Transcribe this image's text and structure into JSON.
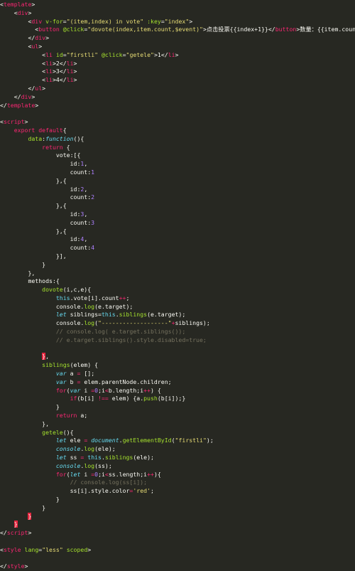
{
  "editor": {
    "lines": [
      [
        [
          "c-punct",
          "<"
        ],
        [
          "c-tag",
          "template"
        ],
        [
          "c-punct",
          ">"
        ]
      ],
      [
        [
          "c-plain",
          "    "
        ],
        [
          "c-punct",
          "<"
        ],
        [
          "c-tag",
          "div"
        ],
        [
          "c-punct",
          ">"
        ]
      ],
      [
        [
          "c-plain",
          "        "
        ],
        [
          "c-punct",
          "<"
        ],
        [
          "c-tag",
          "div"
        ],
        [
          "c-plain",
          " "
        ],
        [
          "c-attr",
          "v-for"
        ],
        [
          "c-punct",
          "="
        ],
        [
          "c-str",
          "\"(item,index) in vote\""
        ],
        [
          "c-plain",
          " "
        ],
        [
          "c-attr",
          ":key"
        ],
        [
          "c-punct",
          "="
        ],
        [
          "c-str",
          "\"index\""
        ],
        [
          "c-punct",
          ">"
        ]
      ],
      [
        [
          "c-plain",
          "          "
        ],
        [
          "c-punct",
          "<"
        ],
        [
          "c-tag",
          "button"
        ],
        [
          "c-plain",
          " "
        ],
        [
          "c-attr",
          "@click"
        ],
        [
          "c-punct",
          "="
        ],
        [
          "c-str",
          "\"dovote(index,item.count,$event)\""
        ],
        [
          "c-punct",
          ">"
        ],
        [
          "c-plain c-zh",
          "点击投票"
        ],
        [
          "c-plain",
          "{{index+1}}"
        ],
        [
          "c-punct",
          "</"
        ],
        [
          "c-tag",
          "button"
        ],
        [
          "c-punct",
          ">"
        ],
        [
          "c-plain c-zh",
          "数量："
        ],
        [
          "c-plain",
          "{{item.count}}"
        ]
      ],
      [
        [
          "c-plain",
          "        "
        ],
        [
          "c-punct",
          "</"
        ],
        [
          "c-tag",
          "div"
        ],
        [
          "c-punct",
          ">"
        ]
      ],
      [
        [
          "c-plain",
          "        "
        ],
        [
          "c-punct",
          "<"
        ],
        [
          "c-tag",
          "ul"
        ],
        [
          "c-punct",
          ">"
        ]
      ],
      [
        [
          "c-plain",
          "            "
        ],
        [
          "c-punct",
          "<"
        ],
        [
          "c-tag",
          "li"
        ],
        [
          "c-plain",
          " "
        ],
        [
          "c-attr",
          "id"
        ],
        [
          "c-punct",
          "="
        ],
        [
          "c-str",
          "\"firstli\""
        ],
        [
          "c-plain",
          " "
        ],
        [
          "c-attr",
          "@click"
        ],
        [
          "c-punct",
          "="
        ],
        [
          "c-str",
          "\"getele\""
        ],
        [
          "c-punct",
          ">"
        ],
        [
          "c-plain",
          "1"
        ],
        [
          "c-punct",
          "</"
        ],
        [
          "c-tag",
          "li"
        ],
        [
          "c-punct",
          ">"
        ]
      ],
      [
        [
          "c-plain",
          "            "
        ],
        [
          "c-punct",
          "<"
        ],
        [
          "c-tag",
          "li"
        ],
        [
          "c-punct",
          ">"
        ],
        [
          "c-plain",
          "2"
        ],
        [
          "c-punct",
          "</"
        ],
        [
          "c-tag",
          "li"
        ],
        [
          "c-punct",
          ">"
        ]
      ],
      [
        [
          "c-plain",
          "            "
        ],
        [
          "c-punct",
          "<"
        ],
        [
          "c-tag",
          "li"
        ],
        [
          "c-punct",
          ">"
        ],
        [
          "c-plain",
          "3"
        ],
        [
          "c-punct",
          "</"
        ],
        [
          "c-tag",
          "li"
        ],
        [
          "c-punct",
          ">"
        ]
      ],
      [
        [
          "c-plain",
          "            "
        ],
        [
          "c-punct",
          "<"
        ],
        [
          "c-tag",
          "li"
        ],
        [
          "c-punct",
          ">"
        ],
        [
          "c-plain",
          "4"
        ],
        [
          "c-punct",
          "</"
        ],
        [
          "c-tag",
          "li"
        ],
        [
          "c-punct",
          ">"
        ]
      ],
      [
        [
          "c-plain",
          "        "
        ],
        [
          "c-punct",
          "</"
        ],
        [
          "c-tag",
          "ul"
        ],
        [
          "c-punct",
          ">"
        ]
      ],
      [
        [
          "c-plain",
          "    "
        ],
        [
          "c-punct",
          "</"
        ],
        [
          "c-tag",
          "div"
        ],
        [
          "c-punct",
          ">"
        ]
      ],
      [
        [
          "c-punct",
          "</"
        ],
        [
          "c-tag",
          "template"
        ],
        [
          "c-punct",
          ">"
        ]
      ],
      [
        [
          "c-plain",
          ""
        ]
      ],
      [
        [
          "c-punct",
          "<"
        ],
        [
          "c-tag",
          "script"
        ],
        [
          "c-punct",
          ">"
        ]
      ],
      [
        [
          "c-plain",
          "    "
        ],
        [
          "c-kw",
          "export"
        ],
        [
          "c-plain",
          " "
        ],
        [
          "c-kw",
          "default"
        ],
        [
          "c-plain",
          "{"
        ]
      ],
      [
        [
          "c-plain",
          "        "
        ],
        [
          "c-fn",
          "data"
        ],
        [
          "c-plain",
          ":"
        ],
        [
          "c-storage",
          "function"
        ],
        [
          "c-plain",
          "(){"
        ]
      ],
      [
        [
          "c-plain",
          "            "
        ],
        [
          "c-kw",
          "return"
        ],
        [
          "c-plain",
          " {"
        ]
      ],
      [
        [
          "c-plain",
          "                "
        ],
        [
          "c-plain",
          "vote:[{"
        ]
      ],
      [
        [
          "c-plain",
          "                    "
        ],
        [
          "c-plain",
          "id:"
        ],
        [
          "c-num",
          "1"
        ],
        [
          "c-plain",
          ","
        ]
      ],
      [
        [
          "c-plain",
          "                    "
        ],
        [
          "c-plain",
          "count:"
        ],
        [
          "c-num",
          "1"
        ]
      ],
      [
        [
          "c-plain",
          "                "
        ],
        [
          "c-plain",
          "},{"
        ]
      ],
      [
        [
          "c-plain",
          "                    "
        ],
        [
          "c-plain",
          "id:"
        ],
        [
          "c-num",
          "2"
        ],
        [
          "c-plain",
          ","
        ]
      ],
      [
        [
          "c-plain",
          "                    "
        ],
        [
          "c-plain",
          "count:"
        ],
        [
          "c-num",
          "2"
        ]
      ],
      [
        [
          "c-plain",
          "                "
        ],
        [
          "c-plain",
          "},{"
        ]
      ],
      [
        [
          "c-plain",
          "                    "
        ],
        [
          "c-plain",
          "id:"
        ],
        [
          "c-num",
          "3"
        ],
        [
          "c-plain",
          ","
        ]
      ],
      [
        [
          "c-plain",
          "                    "
        ],
        [
          "c-plain",
          "count:"
        ],
        [
          "c-num",
          "3"
        ]
      ],
      [
        [
          "c-plain",
          "                "
        ],
        [
          "c-plain",
          "},{"
        ]
      ],
      [
        [
          "c-plain",
          "                    "
        ],
        [
          "c-plain",
          "id:"
        ],
        [
          "c-num",
          "4"
        ],
        [
          "c-plain",
          ","
        ]
      ],
      [
        [
          "c-plain",
          "                    "
        ],
        [
          "c-plain",
          "count:"
        ],
        [
          "c-num",
          "4"
        ]
      ],
      [
        [
          "c-plain",
          "                "
        ],
        [
          "c-plain",
          "}],"
        ]
      ],
      [
        [
          "c-plain",
          "            "
        ],
        [
          "c-plain",
          "}"
        ]
      ],
      [
        [
          "c-plain",
          "        "
        ],
        [
          "c-plain",
          "},"
        ]
      ],
      [
        [
          "c-plain",
          "        "
        ],
        [
          "c-plain",
          "methods:{"
        ]
      ],
      [
        [
          "c-plain",
          "            "
        ],
        [
          "c-fn",
          "dovote"
        ],
        [
          "c-plain",
          "(i,c,e){"
        ]
      ],
      [
        [
          "c-plain",
          "                "
        ],
        [
          "c-prop",
          "this"
        ],
        [
          "c-plain",
          ".vote["
        ],
        [
          "c-plain",
          "i"
        ],
        [
          "c-plain",
          "].count"
        ],
        [
          "c-kw",
          "++"
        ],
        [
          "c-plain",
          ";"
        ]
      ],
      [
        [
          "c-plain",
          "                "
        ],
        [
          "c-plain",
          "console."
        ],
        [
          "c-fn",
          "log"
        ],
        [
          "c-plain",
          "(e.target);"
        ]
      ],
      [
        [
          "c-plain",
          "                "
        ],
        [
          "c-storage",
          "let"
        ],
        [
          "c-plain",
          " siblings="
        ],
        [
          "c-prop",
          "this"
        ],
        [
          "c-plain",
          "."
        ],
        [
          "c-fn",
          "siblings"
        ],
        [
          "c-plain",
          "(e.target);"
        ]
      ],
      [
        [
          "c-plain",
          "                "
        ],
        [
          "c-plain",
          "console."
        ],
        [
          "c-fn",
          "log"
        ],
        [
          "c-plain",
          "("
        ],
        [
          "c-str",
          "\"-------------------\""
        ],
        [
          "c-kw",
          "+"
        ],
        [
          "c-plain",
          "siblings);"
        ]
      ],
      [
        [
          "c-plain",
          "                "
        ],
        [
          "c-comment",
          "// console.log( e.target.siblings());"
        ]
      ],
      [
        [
          "c-plain",
          "                "
        ],
        [
          "c-comment",
          "// e.target.siblings().style.disabled=true;"
        ]
      ],
      [
        [
          "c-plain",
          ""
        ]
      ],
      [
        [
          "c-plain",
          "            "
        ],
        [
          "c-hl",
          "}"
        ],
        [
          "c-plain",
          ","
        ]
      ],
      [
        [
          "c-plain",
          "            "
        ],
        [
          "c-fn",
          "siblings"
        ],
        [
          "c-plain",
          "(elem) {"
        ]
      ],
      [
        [
          "c-plain",
          "                "
        ],
        [
          "c-storage",
          "var"
        ],
        [
          "c-plain",
          " a "
        ],
        [
          "c-kw",
          "="
        ],
        [
          "c-plain",
          " [];"
        ]
      ],
      [
        [
          "c-plain",
          "                "
        ],
        [
          "c-storage",
          "var"
        ],
        [
          "c-plain",
          " b "
        ],
        [
          "c-kw",
          "="
        ],
        [
          "c-plain",
          " elem.parentNode.children;"
        ]
      ],
      [
        [
          "c-plain",
          "                "
        ],
        [
          "c-kw",
          "for"
        ],
        [
          "c-plain",
          "("
        ],
        [
          "c-storage",
          "var"
        ],
        [
          "c-plain",
          " i "
        ],
        [
          "c-kw",
          "="
        ],
        [
          "c-num",
          "0"
        ],
        [
          "c-plain",
          ";i"
        ],
        [
          "c-kw",
          "<"
        ],
        [
          "c-plain",
          "b.length;i"
        ],
        [
          "c-kw",
          "++"
        ],
        [
          "c-plain",
          ") {"
        ]
      ],
      [
        [
          "c-plain",
          "                    "
        ],
        [
          "c-kw",
          "if"
        ],
        [
          "c-plain",
          "(b[i] "
        ],
        [
          "c-kw",
          "!=="
        ],
        [
          "c-plain",
          " elem) {a."
        ],
        [
          "c-fn",
          "push"
        ],
        [
          "c-plain",
          "(b[i]);}"
        ]
      ],
      [
        [
          "c-plain",
          "                "
        ],
        [
          "c-plain",
          "}"
        ]
      ],
      [
        [
          "c-plain",
          "                "
        ],
        [
          "c-kw",
          "return"
        ],
        [
          "c-plain",
          " a;"
        ]
      ],
      [
        [
          "c-plain",
          "            "
        ],
        [
          "c-plain",
          "},"
        ]
      ],
      [
        [
          "c-plain",
          "            "
        ],
        [
          "c-fn",
          "getele"
        ],
        [
          "c-plain",
          "(){"
        ]
      ],
      [
        [
          "c-plain",
          "                "
        ],
        [
          "c-storage",
          "let"
        ],
        [
          "c-plain",
          " ele "
        ],
        [
          "c-kw",
          "="
        ],
        [
          "c-plain",
          " "
        ],
        [
          "c-storage",
          "document"
        ],
        [
          "c-plain",
          "."
        ],
        [
          "c-fn",
          "getElementById"
        ],
        [
          "c-plain",
          "("
        ],
        [
          "c-str",
          "\"firstli\""
        ],
        [
          "c-plain",
          ");"
        ]
      ],
      [
        [
          "c-plain",
          "                "
        ],
        [
          "c-storage",
          "console"
        ],
        [
          "c-plain",
          "."
        ],
        [
          "c-fn",
          "log"
        ],
        [
          "c-plain",
          "(ele);"
        ]
      ],
      [
        [
          "c-plain",
          "                "
        ],
        [
          "c-storage",
          "let"
        ],
        [
          "c-plain",
          " ss "
        ],
        [
          "c-kw",
          "="
        ],
        [
          "c-plain",
          " "
        ],
        [
          "c-prop",
          "this"
        ],
        [
          "c-plain",
          "."
        ],
        [
          "c-fn",
          "siblings"
        ],
        [
          "c-plain",
          "(ele);"
        ]
      ],
      [
        [
          "c-plain",
          "                "
        ],
        [
          "c-storage",
          "console"
        ],
        [
          "c-plain",
          "."
        ],
        [
          "c-fn",
          "log"
        ],
        [
          "c-plain",
          "(ss);"
        ]
      ],
      [
        [
          "c-plain",
          "                "
        ],
        [
          "c-kw",
          "for"
        ],
        [
          "c-plain",
          "("
        ],
        [
          "c-storage",
          "let"
        ],
        [
          "c-plain",
          " i "
        ],
        [
          "c-kw",
          "="
        ],
        [
          "c-num",
          "0"
        ],
        [
          "c-plain",
          ";i"
        ],
        [
          "c-kw",
          "<"
        ],
        [
          "c-plain",
          "ss.length;i"
        ],
        [
          "c-kw",
          "++"
        ],
        [
          "c-plain",
          "){"
        ]
      ],
      [
        [
          "c-plain",
          "                    "
        ],
        [
          "c-comment",
          "// console.log(ss[i]);"
        ]
      ],
      [
        [
          "c-plain",
          "                    "
        ],
        [
          "c-plain",
          "ss[i].style.color"
        ],
        [
          "c-kw",
          "="
        ],
        [
          "c-str",
          "'red'"
        ],
        [
          "c-plain",
          ";"
        ]
      ],
      [
        [
          "c-plain",
          "                "
        ],
        [
          "c-plain",
          "}"
        ]
      ],
      [
        [
          "c-plain",
          "            "
        ],
        [
          "c-plain",
          "}"
        ]
      ],
      [
        [
          "c-plain",
          "        "
        ],
        [
          "c-hl",
          "}"
        ]
      ],
      [
        [
          "c-plain",
          "    "
        ],
        [
          "c-hl",
          "}"
        ]
      ],
      [
        [
          "c-punct",
          "</"
        ],
        [
          "c-tag",
          "script"
        ],
        [
          "c-punct",
          ">"
        ]
      ],
      [
        [
          "c-plain",
          ""
        ]
      ],
      [
        [
          "c-punct",
          "<"
        ],
        [
          "c-tag",
          "style"
        ],
        [
          "c-plain",
          " "
        ],
        [
          "c-attr",
          "lang"
        ],
        [
          "c-punct",
          "="
        ],
        [
          "c-str",
          "\"less\""
        ],
        [
          "c-plain",
          " "
        ],
        [
          "c-attr",
          "scoped"
        ],
        [
          "c-punct",
          ">"
        ]
      ],
      [
        [
          "c-plain",
          ""
        ]
      ],
      [
        [
          "c-punct",
          "</"
        ],
        [
          "c-tag",
          "style"
        ],
        [
          "c-punct",
          ">"
        ]
      ]
    ]
  }
}
